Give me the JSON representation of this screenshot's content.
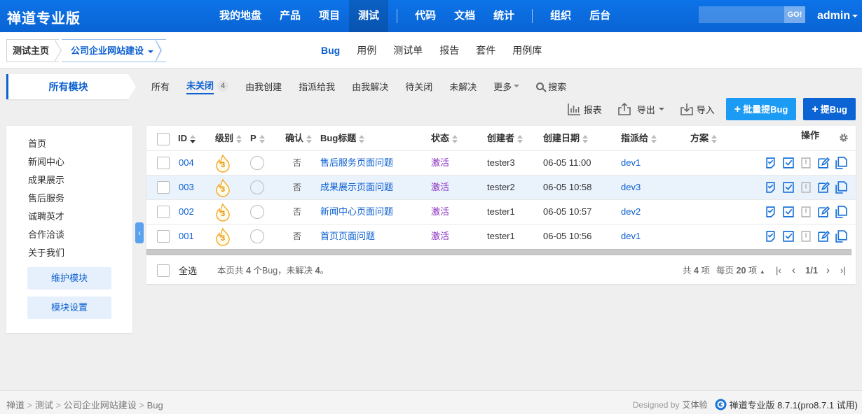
{
  "header": {
    "brand": "禅道专业版",
    "nav": [
      "我的地盘",
      "产品",
      "项目",
      "测试",
      "代码",
      "文档",
      "统计",
      "组织",
      "后台"
    ],
    "active_nav": "测试",
    "search_button": "GO!",
    "user": "admin"
  },
  "subheader": {
    "crumb_home": "测试主页",
    "crumb_product": "公司企业网站建设",
    "tabs": [
      "Bug",
      "用例",
      "测试单",
      "报告",
      "套件",
      "用例库"
    ],
    "active_tab": "Bug"
  },
  "sidebar": {
    "title": "所有模块",
    "modules": [
      "首页",
      "新闻中心",
      "成果展示",
      "售后服务",
      "诚聘英才",
      "合作洽谈",
      "关于我们"
    ],
    "maintain_button": "维护模块",
    "settings_button": "模块设置"
  },
  "filters": {
    "items": [
      "所有",
      "未关闭",
      "由我创建",
      "指派给我",
      "由我解决",
      "待关闭",
      "未解决",
      "更多"
    ],
    "active": "未关闭",
    "active_count": "4",
    "search": "搜索"
  },
  "toolbar": {
    "report": "报表",
    "export": "导出",
    "import": "导入",
    "batch_create": "批量提Bug",
    "create": "提Bug"
  },
  "table": {
    "columns": {
      "id": "ID",
      "severity": "级别",
      "priority": "P",
      "confirmed": "确认",
      "title": "Bug标题",
      "status": "状态",
      "creator": "创建者",
      "created": "创建日期",
      "assigned": "指派给",
      "resolution": "方案",
      "actions": "操作"
    },
    "rows": [
      {
        "id": "004",
        "severity": "3",
        "confirmed": "否",
        "title": "售后服务页面问题",
        "status": "激活",
        "creator": "tester3",
        "created": "06-05 11:00",
        "assigned": "dev1"
      },
      {
        "id": "003",
        "severity": "3",
        "confirmed": "否",
        "title": "成果展示页面问题",
        "status": "激活",
        "creator": "tester2",
        "created": "06-05 10:58",
        "assigned": "dev3"
      },
      {
        "id": "002",
        "severity": "3",
        "confirmed": "否",
        "title": "新闻中心页面问题",
        "status": "激活",
        "creator": "tester1",
        "created": "06-05 10:57",
        "assigned": "dev2"
      },
      {
        "id": "001",
        "severity": "3",
        "confirmed": "否",
        "title": "首页页面问题",
        "status": "激活",
        "creator": "tester1",
        "created": "06-05 10:56",
        "assigned": "dev1"
      }
    ],
    "highlighted_row": 1,
    "footer": {
      "select_all": "全选",
      "summary_pre": "本页共",
      "summary_count": "4",
      "summary_mid": "个Bug，未解决",
      "summary_unresolved": "4",
      "summary_end": "。",
      "total_pre": "共",
      "total": "4",
      "total_unit": "项",
      "per_page_pre": "每页",
      "per_page": "20",
      "per_page_unit": "项",
      "page": "1/1"
    }
  },
  "footer": {
    "breadcrumb": [
      "禅道",
      "测试",
      "公司企业网站建设",
      "Bug"
    ],
    "designed_by_label": "Designed by",
    "designed_by": "艾体验",
    "version": "禅道专业版 8.7.1(pro8.7.1 试用)"
  },
  "colors": {
    "primary": "#0c64d4",
    "accent": "#1c9bf5",
    "status_active": "#8a2fbf",
    "severity_flame": "#f5a623"
  },
  "icons": [
    "search-icon",
    "report-icon",
    "export-icon",
    "import-icon",
    "plus-icon",
    "gear-icon",
    "flame-icon",
    "confirm-icon",
    "resolve-icon",
    "close-icon",
    "edit-icon",
    "copy-icon",
    "chevron-left-icon",
    "zentao-logo-icon"
  ]
}
